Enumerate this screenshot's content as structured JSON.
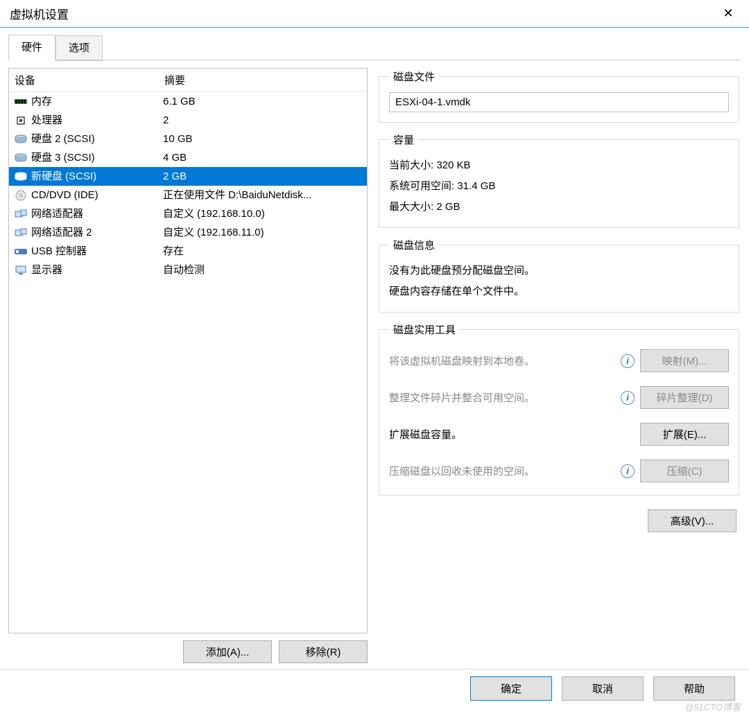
{
  "window": {
    "title": "虚拟机设置",
    "close_glyph": "✕"
  },
  "tabs": {
    "hardware": "硬件",
    "options": "选项"
  },
  "list": {
    "col_device": "设备",
    "col_summary": "摘要",
    "rows": [
      {
        "name": "内存",
        "summary": "6.1 GB",
        "icon": "memory",
        "sel": false
      },
      {
        "name": "处理器",
        "summary": "2",
        "icon": "cpu",
        "sel": false
      },
      {
        "name": "硬盘 2 (SCSI)",
        "summary": "10 GB",
        "icon": "disk",
        "sel": false
      },
      {
        "name": "硬盘 3 (SCSI)",
        "summary": "4 GB",
        "icon": "disk",
        "sel": false
      },
      {
        "name": "新硬盘 (SCSI)",
        "summary": "2 GB",
        "icon": "disk-b",
        "sel": true
      },
      {
        "name": "CD/DVD (IDE)",
        "summary": "正在使用文件 D:\\BaiduNetdisk...",
        "icon": "cd",
        "sel": false
      },
      {
        "name": "网络适配器",
        "summary": "自定义 (192.168.10.0)",
        "icon": "net",
        "sel": false
      },
      {
        "name": "网络适配器 2",
        "summary": "自定义 (192.168.11.0)",
        "icon": "net",
        "sel": false
      },
      {
        "name": "USB 控制器",
        "summary": "存在",
        "icon": "usb",
        "sel": false
      },
      {
        "name": "显示器",
        "summary": "自动检测",
        "icon": "display",
        "sel": false
      }
    ]
  },
  "below": {
    "add": "添加(A)...",
    "remove": "移除(R)"
  },
  "diskfile": {
    "legend": "磁盘文件",
    "value": "ESXi-04-1.vmdk"
  },
  "capacity": {
    "legend": "容量",
    "current_label": "当前大小:",
    "current_value": "320 KB",
    "avail_label": "系统可用空间:",
    "avail_value": "31.4 GB",
    "max_label": "最大大小:",
    "max_value": "2 GB"
  },
  "diskinfo": {
    "legend": "磁盘信息",
    "line1": "没有为此硬盘预分配磁盘空间。",
    "line2": "硬盘内容存储在单个文件中。"
  },
  "utils": {
    "legend": "磁盘实用工具",
    "map_desc": "将该虚拟机磁盘映射到本地卷。",
    "map_btn": "映射(M)...",
    "defrag_desc": "整理文件碎片并整合可用空间。",
    "defrag_btn": "碎片整理(D)",
    "expand_desc": "扩展磁盘容量。",
    "expand_btn": "扩展(E)...",
    "compact_desc": "压缩磁盘以回收未使用的空间。",
    "compact_btn": "压缩(C)"
  },
  "advanced_btn": "高级(V)...",
  "footer": {
    "ok": "确定",
    "cancel": "取消",
    "help": "帮助"
  },
  "watermark": "@51CTO博客"
}
